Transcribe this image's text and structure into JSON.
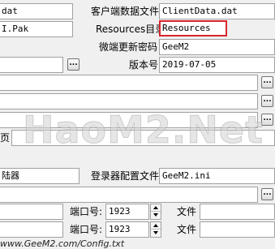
{
  "fields": {
    "dat_left": "dat",
    "client_data_label": "客户端数据文件",
    "client_data_value": "ClientData.dat",
    "pak_left": "I.Pak",
    "resources_label": "Resources目录",
    "resources_value": "Resources",
    "update_pwd_label": "微端更新密码",
    "update_pwd_value": "GeeM2",
    "version_label": "版本号",
    "version_value": "2019-07-05",
    "launcher_left": "陆器",
    "login_config_label": "登录器配置文件",
    "login_config_value": "GeeM2.ini",
    "partial_label_left": "页",
    "port_label_1": "端口号:",
    "port_value_1": "1923",
    "file_label_1": "文件",
    "port_label_2": "端口号:",
    "port_value_2": "1923",
    "file_label_2": "文件"
  },
  "buttons": {
    "browse": "..."
  },
  "watermark": "HaoM2.Net",
  "footer_url": "www.GeeM2.com/Config.txt",
  "colors": {
    "highlight_border": "#d8262e",
    "background": "#f0f0f0"
  }
}
